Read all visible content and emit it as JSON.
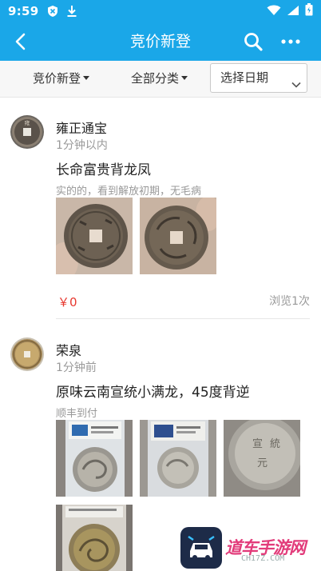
{
  "status_bar": {
    "time": "9:59"
  },
  "app_bar": {
    "title": "竞价新登"
  },
  "filters": {
    "tab1": "竞价新登",
    "tab2": "全部分类",
    "date_placeholder": "选择日期"
  },
  "posts": [
    {
      "username": "雍正通宝",
      "time": "1分钟以内",
      "title": "长命富贵背龙凤",
      "description": "实的的，看到解放初期，无毛病",
      "price": "￥0",
      "views": "浏览1次",
      "images": [
        "coin-front-photo",
        "coin-back-photo"
      ]
    },
    {
      "username": "荣泉",
      "time": "1分钟前",
      "title": "原味云南宣统小满龙，45度背逆",
      "description": "顺丰到付",
      "images": [
        "graded-coin-slab-photo",
        "graded-coin-slab-photo",
        "coin-closeup-photo",
        "graded-coin-dragon-photo"
      ]
    }
  ],
  "watermark": {
    "text": "道车手游网",
    "sub": "CH17Z.COM"
  },
  "colors": {
    "primary": "#1aa7e8",
    "price": "#e7382f",
    "muted": "#999999"
  }
}
